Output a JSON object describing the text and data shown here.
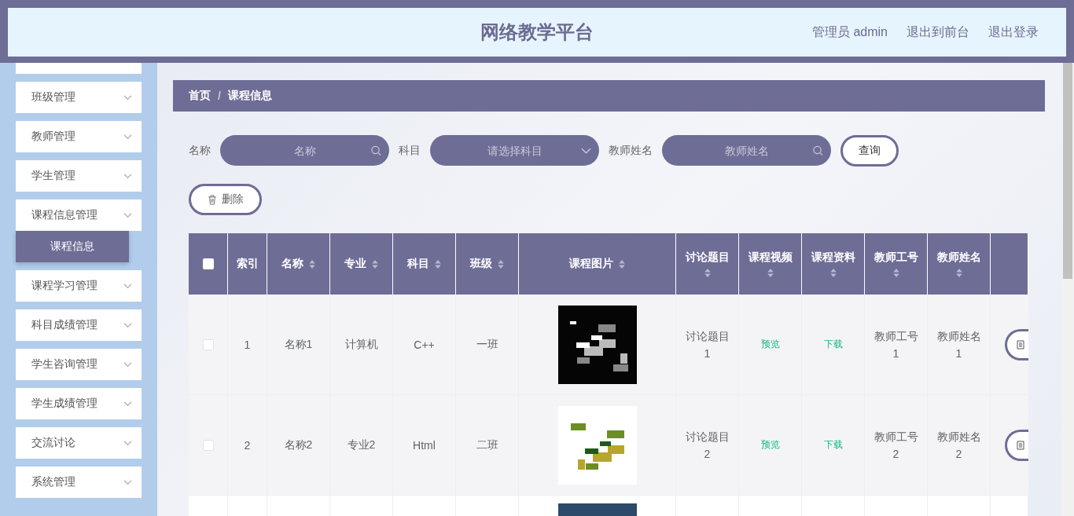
{
  "header": {
    "title": "网络教学平台",
    "links": [
      "管理员 admin",
      "退出到前台",
      "退出登录"
    ]
  },
  "sidebar": {
    "scrolled": true,
    "items": [
      {
        "label": "班级管理"
      },
      {
        "label": "教师管理"
      },
      {
        "label": "学生管理"
      },
      {
        "label": "课程信息管理",
        "children": [
          {
            "label": "课程信息",
            "selected": true
          }
        ]
      },
      {
        "label": "课程学习管理"
      },
      {
        "label": "科目成绩管理"
      },
      {
        "label": "学生咨询管理"
      },
      {
        "label": "学生成绩管理"
      },
      {
        "label": "交流讨论"
      },
      {
        "label": "系统管理"
      }
    ]
  },
  "breadcrumb": {
    "items": [
      "首页",
      "课程信息"
    ],
    "separator": "/"
  },
  "search": {
    "fields": [
      {
        "kind": "input",
        "label": "名称",
        "placeholder": "名称"
      },
      {
        "kind": "select",
        "label": "科目",
        "placeholder": "请选择科目"
      },
      {
        "kind": "input",
        "label": "教师姓名",
        "placeholder": "教师姓名"
      }
    ],
    "button": "查询"
  },
  "delete_button": "删除",
  "table": {
    "all_checked": false,
    "columns": [
      {
        "label": "索引",
        "sortable": false
      },
      {
        "label": "名称",
        "sortable": true
      },
      {
        "label": "专业",
        "sortable": true
      },
      {
        "label": "科目",
        "sortable": true
      },
      {
        "label": "班级",
        "sortable": true
      },
      {
        "label": "课程图片",
        "sortable": true
      },
      {
        "label": "讨论题目",
        "sortable": true
      },
      {
        "label": "课程视频",
        "sortable": true
      },
      {
        "label": "课程资料",
        "sortable": true
      },
      {
        "label": "教师工号",
        "sortable": true
      },
      {
        "label": "教师姓名",
        "sortable": true
      }
    ],
    "rows": [
      {
        "kind": "full",
        "checked": false,
        "cells": [
          "1",
          "名称1",
          "计算机",
          "C++",
          "一班"
        ],
        "topic": "讨论题目1",
        "video": "预览",
        "material": "下载",
        "teacher_id": "教师工号1",
        "teacher_name": "教师姓名1"
      },
      {
        "kind": "full",
        "checked": false,
        "cells": [
          "2",
          "名称2",
          "专业2",
          "Html",
          "二班"
        ],
        "topic": "讨论题目2",
        "video": "预览",
        "material": "下载",
        "teacher_id": "教师工号2",
        "teacher_name": "教师姓名2"
      },
      {
        "kind": "partial"
      }
    ]
  }
}
